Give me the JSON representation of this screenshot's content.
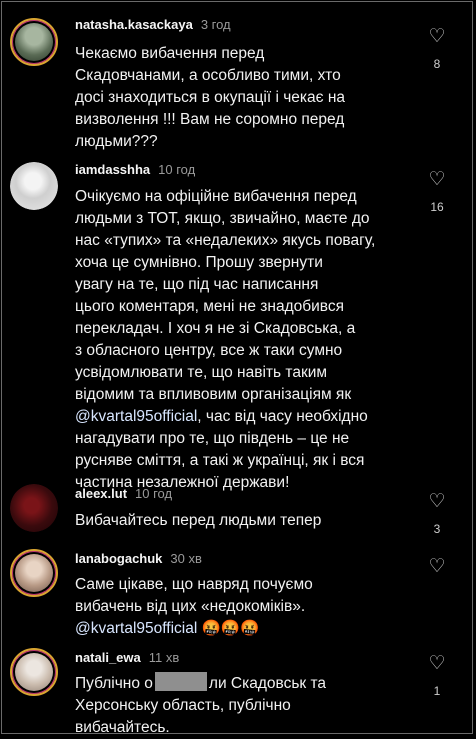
{
  "comments": [
    {
      "user": "natasha.kasackaya",
      "time": "3 год",
      "text": "Чекаємо вибачення перед\nСкадовчанами, а особливо тими, хто\nдосі знаходиться в окупації і чекає на\nвизволення !!! Вам не соромно перед\nлюдьми???",
      "likes": "8",
      "avatar": "profile-photo"
    },
    {
      "user": "iamdasshha",
      "time": "10 год",
      "text_a": "Очікуємо на офіційне вибачення перед\nлюдьми з ТОТ, якщо, звичайно, маєте до\nнас «тупих» та «недалеких» якусь повагу,\nхоча це сумнівно. Прошу звернути\nувагу на те, що під час написання\nцього коментаря, мені не знадобився\nперекладач. І хоч я не зі Скадовська, а\nз обласного центру, все ж таки сумно\nусвідомлювати те, що навіть таким\nвідомим та впливовим організаціям як\n",
      "mention": "@kvartal95official",
      "text_b": ", час від часу необхідно\nнагадувати про те, що південь – це не\nрусняве сміття, а такі ж українці, як і вся\nчастина незалежної держави!",
      "likes": "16",
      "avatar": "profile-photo"
    },
    {
      "user": "aleex.lut",
      "time": "10 год",
      "text": "Вибачайтесь перед людьми тепер",
      "likes": "3",
      "avatar": "profile-photo"
    },
    {
      "user": "lanabogachuk",
      "time": "30 хв",
      "text": "Саме цікаве, що навряд почуємо\nвибачень від цих «недокоміків».",
      "mention": "@kvartal95official",
      "emoji": " 🤬🤬🤬",
      "avatar": "profile-photo"
    },
    {
      "user": "natali_ewa",
      "time": "11 хв",
      "text_a": "Публічно о",
      "text_b": "ли Скадовськ та\nХерсонську область, публічно\nвибачайтесь.",
      "likes": "1",
      "avatar": "profile-photo"
    }
  ],
  "icons": {
    "like": "heart-outline-icon"
  },
  "colors": {
    "background": "#000000",
    "story_ring": "#d8a431",
    "mention": "#d8e6ff"
  }
}
